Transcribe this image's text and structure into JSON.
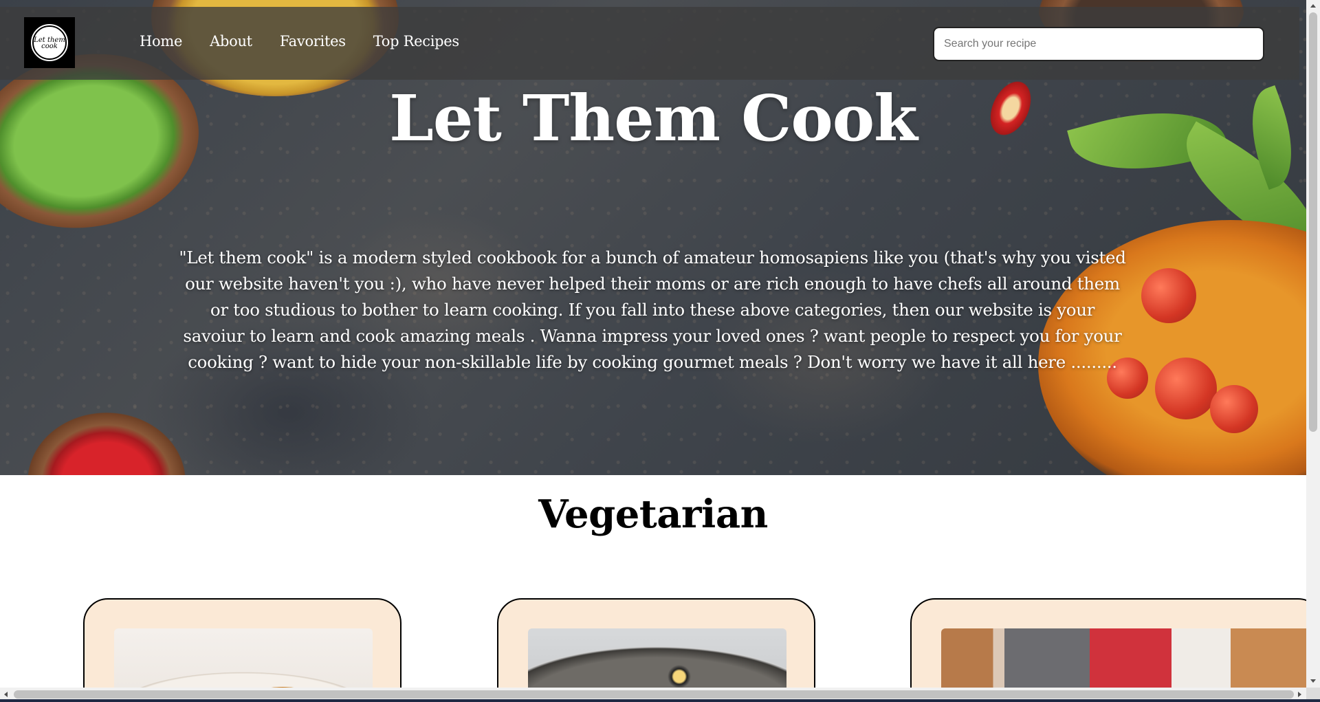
{
  "nav": {
    "logo_text": "Let them cook",
    "links": [
      "Home",
      "About",
      "Favorites",
      "Top Recipes"
    ],
    "search_placeholder": "Search your recipe",
    "search_value": ""
  },
  "hero": {
    "title": "Let Them Cook",
    "description": "\"Let them cook\" is a modern styled cookbook for a bunch of amateur homosapiens like you (that's why you visted our website haven't you :), who have never helped their moms or are rich enough to have chefs all around them or too studious to bother to learn cooking. If you fall into these above categories, then our website is your savoiur to learn and cook amazing meals . Wanna impress your loved ones ? want people to respect you for your cooking ? want to hide your non-skillable life by cooking gourmet meals ? Don't worry we have it all here ........."
  },
  "section": {
    "title": "Vegetarian"
  },
  "colors": {
    "card_background": "#fbe9d6",
    "navbar_background": "rgba(60,60,60,0.78)",
    "text_on_hero": "#ffffff"
  }
}
